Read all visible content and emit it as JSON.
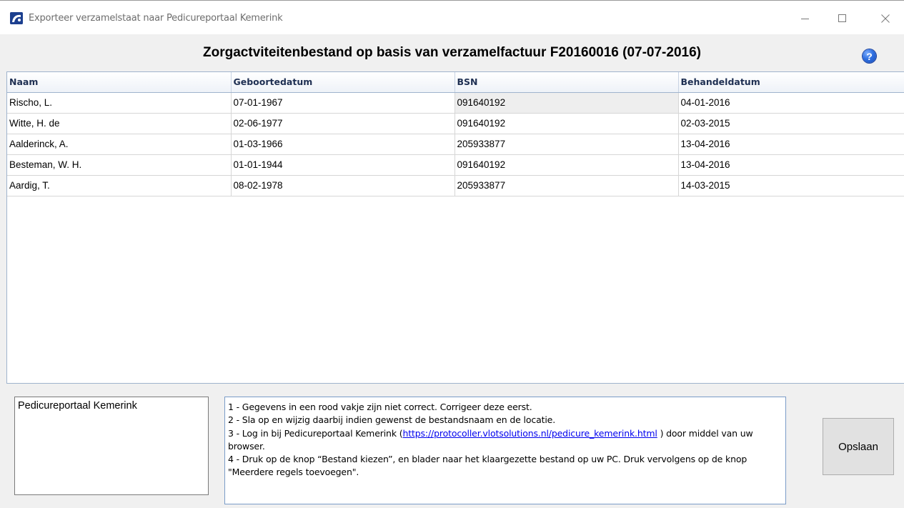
{
  "window": {
    "title": "Exporteer verzamelstaat naar Pedicureportaal Kemerink"
  },
  "heading": "Zorgactviteitenbestand op basis van verzamelfactuur F20160016 (07-07-2016)",
  "help_icon": {
    "icon": "help-icon",
    "glyph": "?"
  },
  "table": {
    "columns": [
      "Naam",
      "Geboortedatum",
      "BSN",
      "Behandeldatum"
    ],
    "rows": [
      [
        "Rischo, L.",
        "07-01-1967",
        "091640192",
        "04-01-2016"
      ],
      [
        "Witte, H.  de",
        "02-06-1977",
        "091640192",
        "02-03-2015"
      ],
      [
        "Aalderinck, A.",
        "01-03-1966",
        "205933877",
        "13-04-2016"
      ],
      [
        "Besteman, W. H.",
        "01-01-1944",
        "091640192",
        "13-04-2016"
      ],
      [
        "Aardig, T.",
        "08-02-1978",
        "205933877",
        "14-03-2015"
      ]
    ]
  },
  "portal_list": {
    "items": [
      "Pedicureportaal Kemerink"
    ]
  },
  "instructions": {
    "line1": "1 - Gegevens in een rood vakje zijn niet correct. Corrigeer deze eerst.",
    "line2": "2 - Sla op en wijzig daarbij indien gewenst de bestandsnaam en de locatie.",
    "line3_pre": "3 - Log in bij Pedicureportaal Kemerink (",
    "line3_link": "https://protocoller.vlotsolutions.nl/pedicure_kemerink.html",
    "line3_post": " ) door middel van uw browser.",
    "line4": "4 - Druk op de knop “Bestand kiezen”, en blader naar het klaargezette bestand op uw PC. Druk vervolgens op de knop \"Meerdere regels toevoegen\"."
  },
  "save_button": {
    "label": "Opslaan"
  },
  "colors": {
    "accent": "#1c3f8f",
    "link": "#0000ee",
    "table_border": "#9fb3cd"
  }
}
